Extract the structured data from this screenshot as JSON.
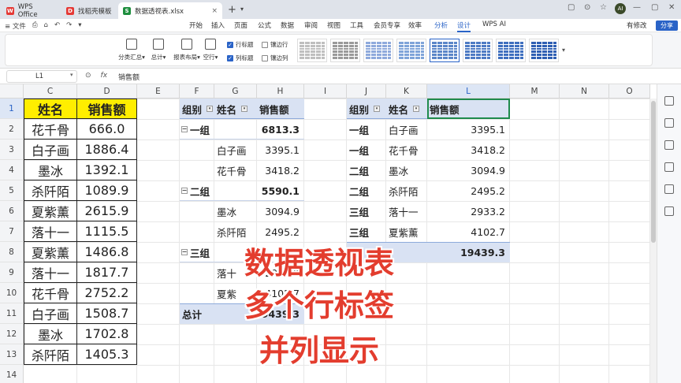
{
  "tabs": [
    {
      "label": "WPS Office",
      "icon": "W",
      "color": "#e53935"
    },
    {
      "label": "找稻壳模板",
      "icon": "D",
      "color": "#e53935"
    },
    {
      "label": "数据透视表.xlsx",
      "icon": "S",
      "color": "#1e8e3e",
      "close": "×"
    }
  ],
  "tab_plus": "+",
  "tab_plus_dd": "▾",
  "window_controls": [
    "▢",
    "⊙",
    "☆",
    "—",
    "▢",
    "✕"
  ],
  "avatar": "AI",
  "menu": {
    "file_items": [
      "≡ 文件",
      "⎙",
      "⌂",
      "↶",
      "↷",
      "▾"
    ],
    "tabs": [
      "开始",
      "插入",
      "页面",
      "公式",
      "数据",
      "审阅",
      "视图",
      "工具",
      "会员专享",
      "效率",
      "分析",
      "设计",
      "WPS AI"
    ],
    "active": "设计",
    "right": [
      "有修改",
      "分享"
    ]
  },
  "ribbon": {
    "buttons": [
      "分类汇总▾",
      "总计▾",
      "报表布局▾",
      "空行▾"
    ],
    "checks": [
      {
        "label": "行标题",
        "on": true
      },
      {
        "label": "镶边行",
        "on": false
      },
      {
        "label": "列标题",
        "on": true
      },
      {
        "label": "镶边列",
        "on": false
      }
    ],
    "check_mark": "✓",
    "styles_more": "▾"
  },
  "formula_bar": {
    "name": "L1",
    "dd": "▾",
    "icons": [
      "⊙",
      "fx"
    ],
    "formula": "销售额"
  },
  "columns": [
    "C",
    "D",
    "E",
    "F",
    "G",
    "H",
    "I",
    "J",
    "K",
    "L",
    "M",
    "N",
    "O"
  ],
  "rows": [
    "1",
    "2",
    "3",
    "4",
    "5",
    "6",
    "7",
    "8",
    "9",
    "10",
    "11",
    "12",
    "13",
    "14"
  ],
  "source_table": {
    "headers": [
      "姓名",
      "销售额"
    ],
    "rows": [
      [
        "花千骨",
        "666.0"
      ],
      [
        "白子画",
        "1886.4"
      ],
      [
        "墨冰",
        "1392.1"
      ],
      [
        "杀阡陌",
        "1089.9"
      ],
      [
        "夏紫薰",
        "2615.9"
      ],
      [
        "落十一",
        "1115.5"
      ],
      [
        "夏紫薰",
        "1486.8"
      ],
      [
        "落十一",
        "1817.7"
      ],
      [
        "花千骨",
        "2752.2"
      ],
      [
        "白子画",
        "1508.7"
      ],
      [
        "墨冰",
        "1702.8"
      ],
      [
        "杀阡陌",
        "1405.3"
      ]
    ]
  },
  "pivot1": {
    "headers": [
      "组别",
      "姓名",
      "销售额"
    ],
    "dd": "▾",
    "minus": "−",
    "groups": [
      {
        "name": "一组",
        "total": "6813.3",
        "items": [
          [
            "白子画",
            "3395.1"
          ],
          [
            "花千骨",
            "3418.2"
          ]
        ]
      },
      {
        "name": "二组",
        "total": "5590.1",
        "items": [
          [
            "墨冰",
            "3094.9"
          ],
          [
            "杀阡陌",
            "2495.2"
          ]
        ]
      },
      {
        "name": "三组",
        "total": "",
        "items": [
          [
            "落十",
            "2933.2"
          ],
          [
            "夏紫",
            "4102.7"
          ]
        ]
      }
    ],
    "grand_label": "总计",
    "grand_total": "19439.3"
  },
  "pivot2": {
    "headers": [
      "组别",
      "姓名",
      "销售额"
    ],
    "rows": [
      [
        "一组",
        "白子画",
        "3395.1"
      ],
      [
        "一组",
        "花千骨",
        "3418.2"
      ],
      [
        "二组",
        "墨冰",
        "3094.9"
      ],
      [
        "二组",
        "杀阡陌",
        "2495.2"
      ],
      [
        "三组",
        "落十一",
        "2933.2"
      ],
      [
        "三组",
        "夏紫薰",
        "4102.7"
      ]
    ],
    "grand_total": "19439.3"
  },
  "overlay_lines": [
    "数据透视表",
    "多个行标签",
    "并列显示"
  ],
  "colors": {
    "accent": "#2a63c7",
    "overlay_red": "#e33d2e",
    "header_yellow": "#ffee00",
    "pivot_band": "#d9e2f3",
    "selection_green": "#1f8a4c"
  }
}
